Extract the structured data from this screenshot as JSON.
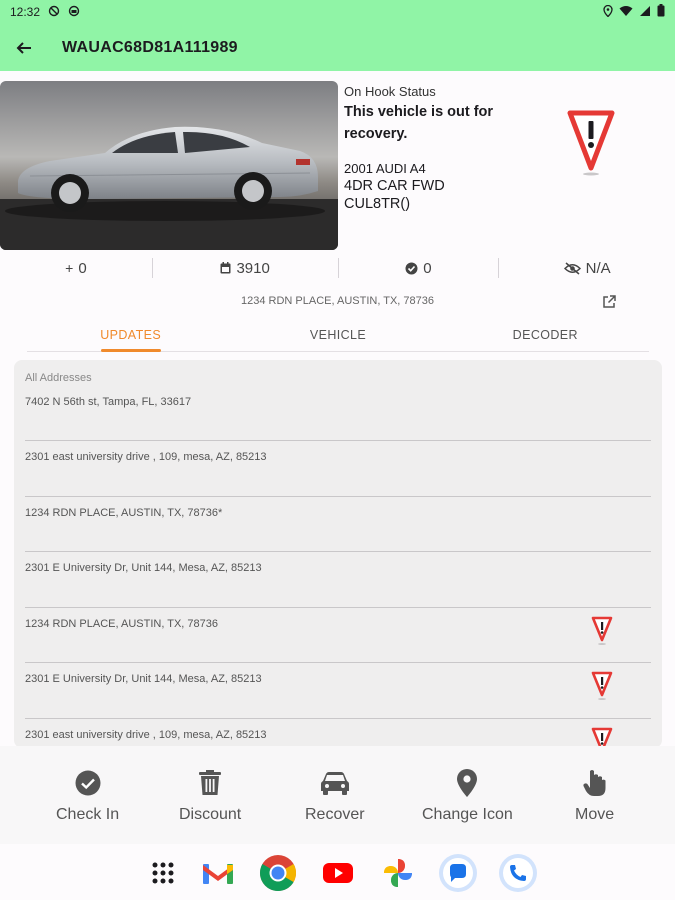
{
  "status_bar": {
    "time": "12:32"
  },
  "app_bar": {
    "title": "WAUAC68D81A111989"
  },
  "vehicle": {
    "status_label": "On Hook Status",
    "status_text": "This vehicle is out for recovery.",
    "year_make_model": "2001 AUDI A4",
    "body": "4DR CAR FWD",
    "plate": "CUL8TR()"
  },
  "stats": {
    "added": "0",
    "days": "3910",
    "checked": "0",
    "visibility": "N/A"
  },
  "address": "1234 RDN PLACE, AUSTIN, TX, 78736",
  "tabs": [
    {
      "label": "UPDATES"
    },
    {
      "label": "VEHICLE"
    },
    {
      "label": "DECODER"
    }
  ],
  "address_list": {
    "header": "All Addresses",
    "items": [
      {
        "text": "7402 N 56th st, Tampa, FL, 33617",
        "warning": false
      },
      {
        "text": "2301 east university drive , 109, mesa, AZ, 85213",
        "warning": false
      },
      {
        "text": "1234 RDN PLACE, AUSTIN, TX, 78736*",
        "warning": false
      },
      {
        "text": "2301 E University Dr, Unit 144, Mesa, AZ, 85213",
        "warning": false
      },
      {
        "text": "1234 RDN PLACE, AUSTIN, TX, 78736",
        "warning": true
      },
      {
        "text": "2301 E University Dr, Unit 144, Mesa, AZ, 85213",
        "warning": true
      },
      {
        "text": "2301 east university drive , 109, mesa, AZ, 85213",
        "warning": true
      }
    ]
  },
  "actions": {
    "check_in": "Check In",
    "discount": "Discount",
    "recover": "Recover",
    "change_icon": "Change Icon",
    "move": "Move"
  },
  "colors": {
    "header_bg": "#90f4a6",
    "accent": "#f08a2c",
    "warning_red": "#e53935"
  }
}
